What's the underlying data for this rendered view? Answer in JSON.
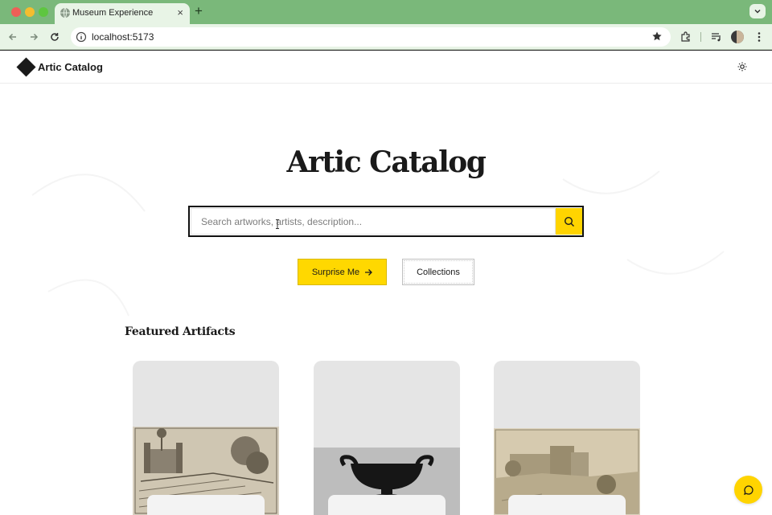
{
  "browser": {
    "tab_title": "Museum Experience",
    "tab_close": "×",
    "new_tab": "+",
    "url": "localhost:5173"
  },
  "header": {
    "logo_text": "Artic Catalog"
  },
  "hero": {
    "title": "Artic Catalog",
    "search_placeholder": "Search artworks, artists, description..."
  },
  "actions": {
    "surprise_label": "Surprise Me",
    "collections_label": "Collections"
  },
  "featured": {
    "title": "Featured Artifacts",
    "cards": [
      {
        "image": "engraving-garden-ruins"
      },
      {
        "image": "black-kylix-vessel"
      },
      {
        "image": "sepia-landscape-castle"
      }
    ]
  },
  "colors": {
    "browser_frame": "#7ab87a",
    "accent": "#ffd400",
    "text": "#1a1a1a"
  },
  "icons": [
    "globe-icon",
    "back-icon",
    "forward-icon",
    "reload-icon",
    "site-info-icon",
    "star-icon",
    "extensions-icon",
    "media-icon",
    "menu-dots-icon",
    "sun-icon",
    "search-icon",
    "arrow-right-icon",
    "chat-icon"
  ]
}
